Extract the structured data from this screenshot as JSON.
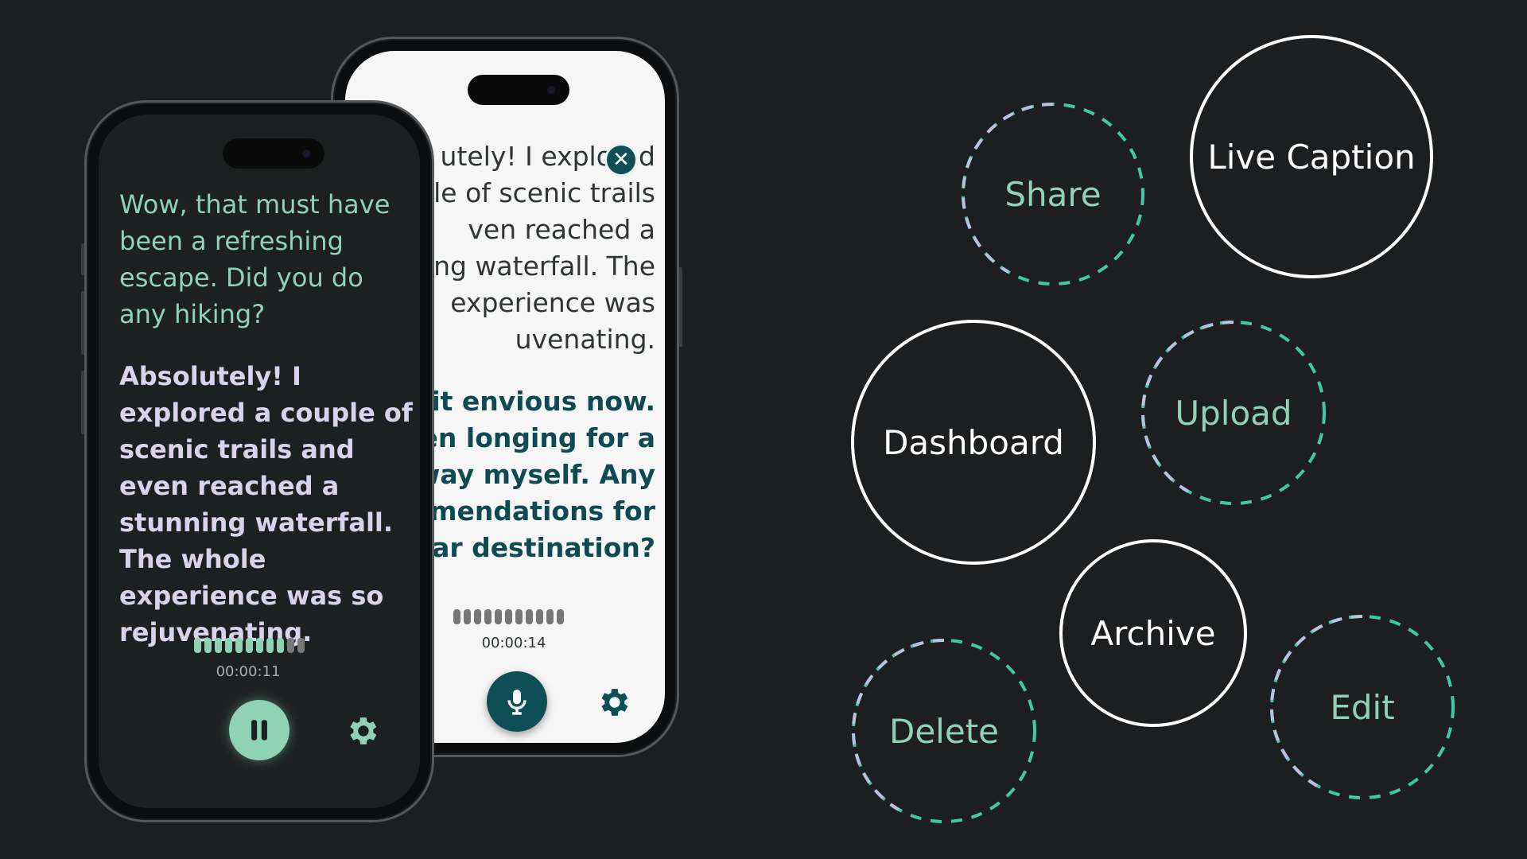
{
  "colors": {
    "background": "#1c1e1f",
    "accent_green": "#8fd2b6",
    "teal_dark": "#0e4a52",
    "lavender": "#d9d2ea",
    "dash_a": "#b9c2dc",
    "dash_b": "#3fc9a4"
  },
  "back_phone": {
    "paragraph_1": "utely! I explored\nble of scenic trails\nven reached a\ning waterfall. The\nexperience was\nuvenating.",
    "paragraph_2": "bit envious now.\neen longing for a\nway myself. Any\nmendations for\nlar destination?",
    "timer": "00:00:14",
    "close_icon": "close-icon",
    "mic_icon": "microphone-icon",
    "settings_icon": "gear-icon"
  },
  "front_phone": {
    "question": "Wow, that must have been a refreshing escape. Did you do any hiking?",
    "answer": "Absolutely! I explored a couple of scenic trails and even reached a stunning waterfall. The whole experience was so rejuvenating.",
    "timer": "00:00:11",
    "pause_icon": "pause-icon",
    "settings_icon": "gear-icon"
  },
  "buttons": {
    "share": "Share",
    "live_caption": "Live Caption",
    "dashboard": "Dashboard",
    "upload": "Upload",
    "archive": "Archive",
    "delete": "Delete",
    "edit": "Edit"
  }
}
